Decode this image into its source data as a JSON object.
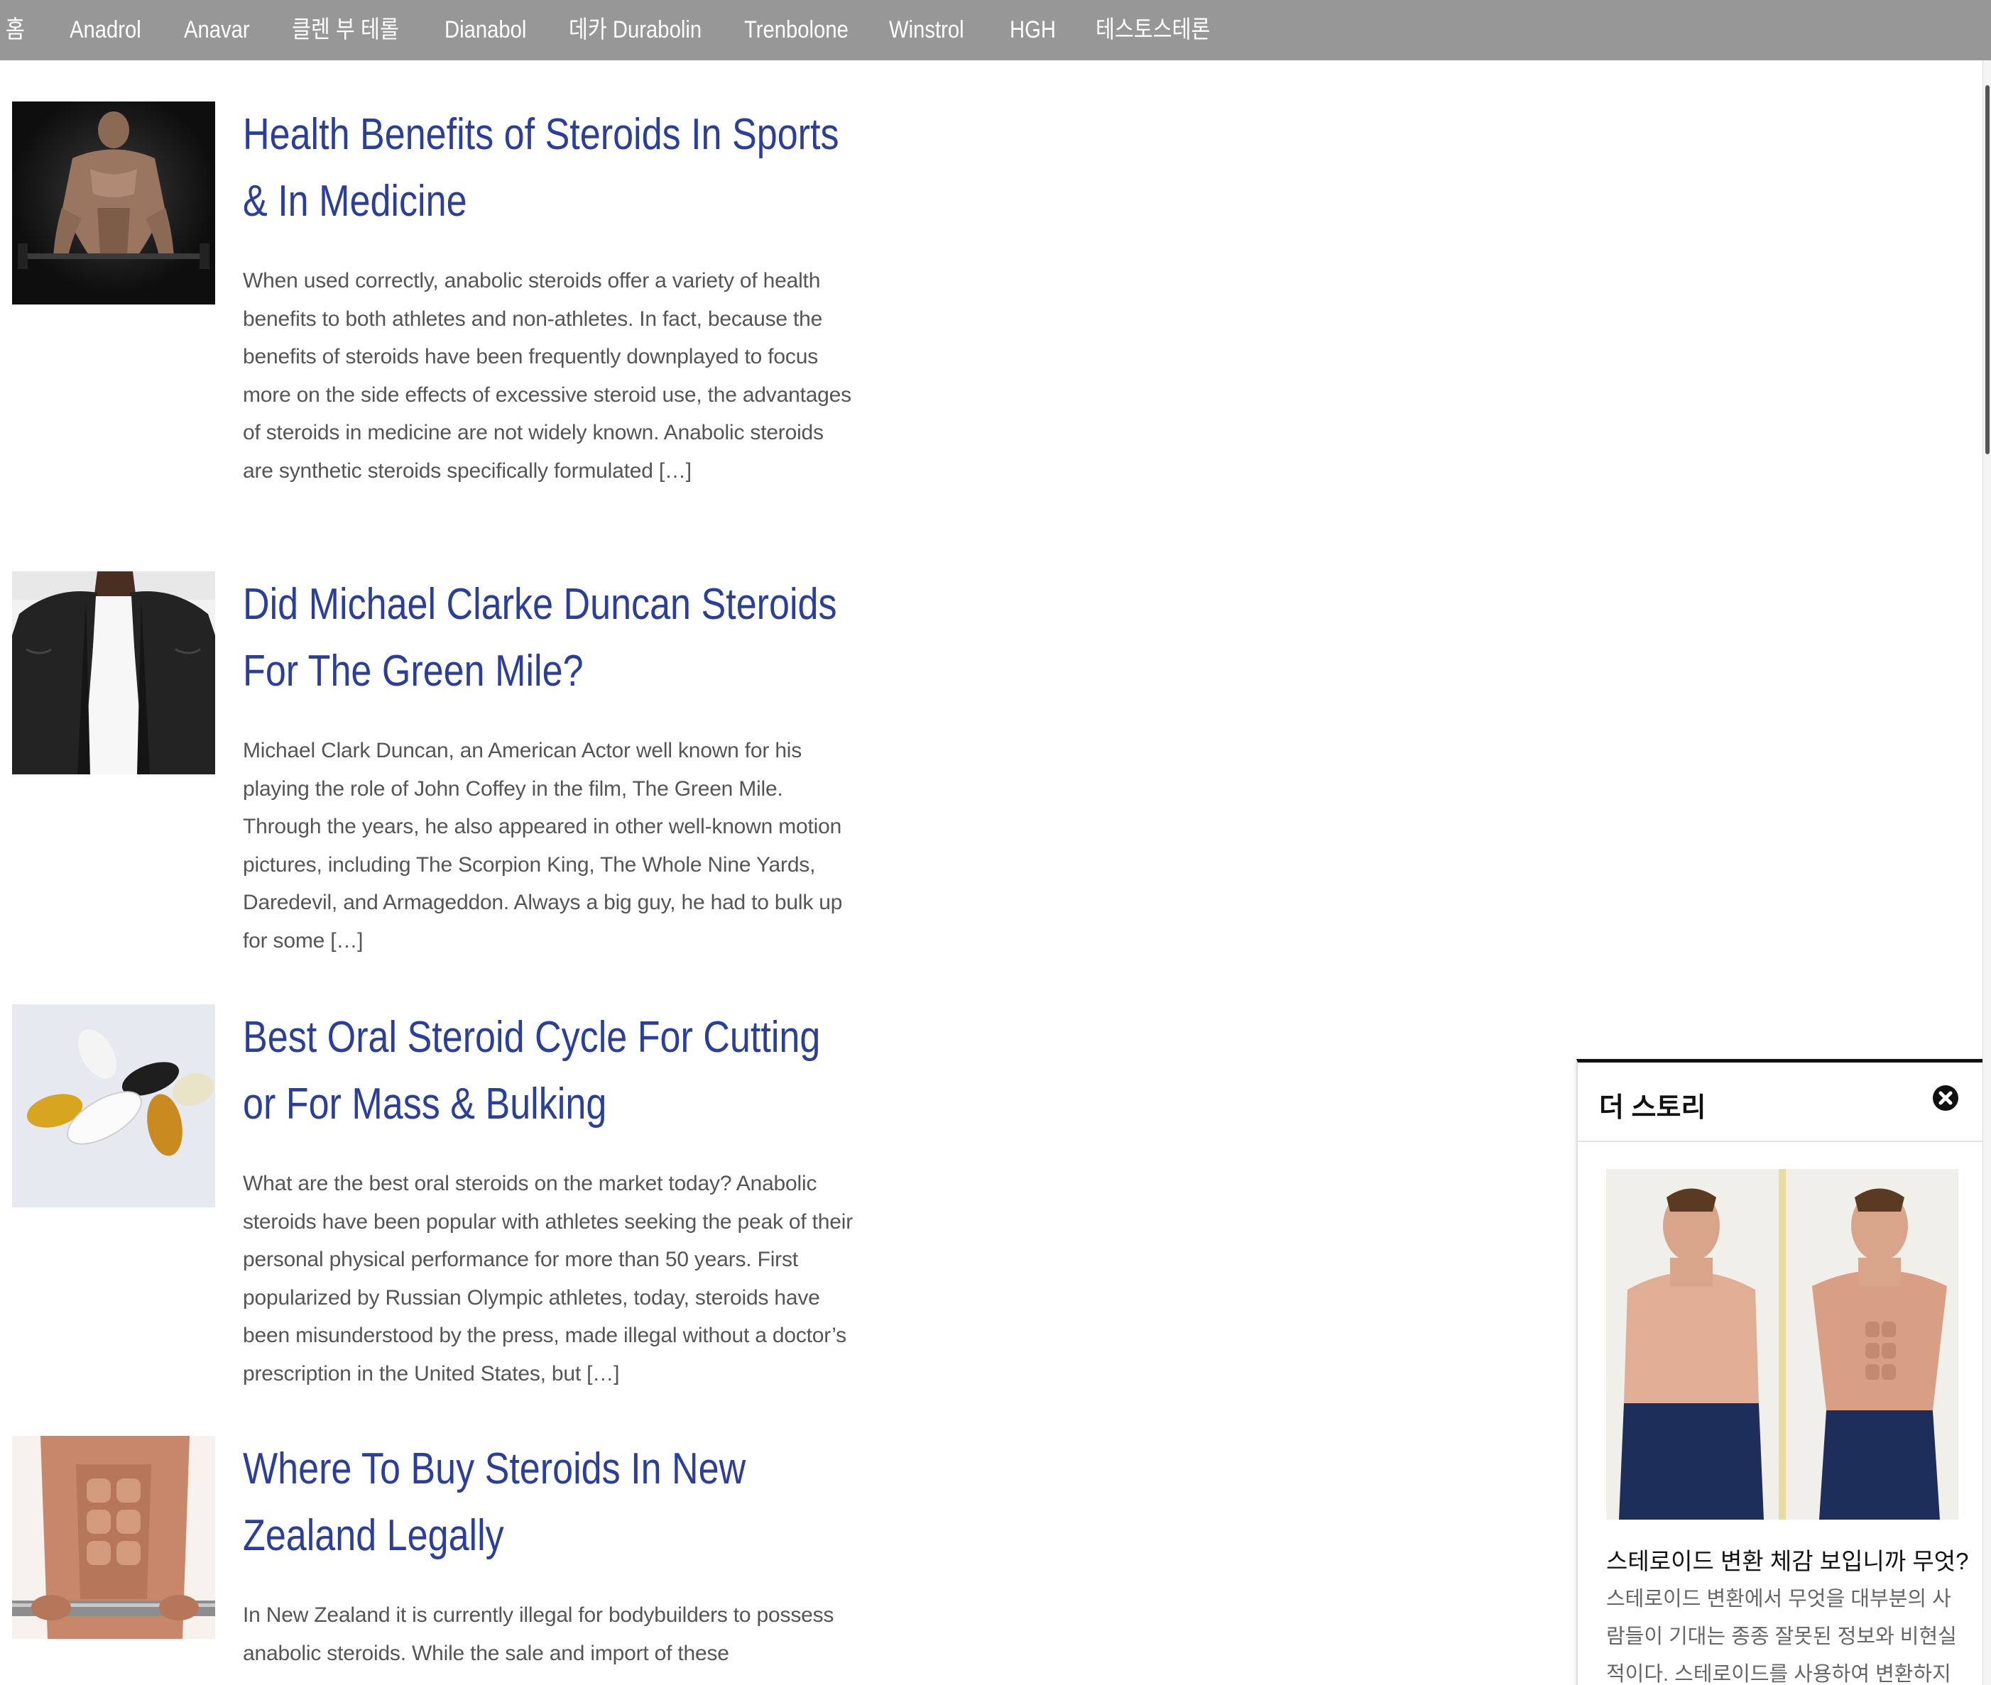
{
  "nav": {
    "items": [
      {
        "label": "홈"
      },
      {
        "label": "Anadrol"
      },
      {
        "label": "Anavar"
      },
      {
        "label": "클렌 부 테롤"
      },
      {
        "label": "Dianabol"
      },
      {
        "label": "데카 Durabolin"
      },
      {
        "label": "Trenbolone"
      },
      {
        "label": "Winstrol"
      },
      {
        "label": "HGH"
      },
      {
        "label": "테스토스테론"
      }
    ]
  },
  "articles": [
    {
      "title": "Health Benefits of Steroids In Sports & In Medicine",
      "excerpt": "When used correctly, anabolic steroids offer a variety of health benefits to both athletes and non-athletes. In fact, because the benefits of steroids have been frequently downplayed to focus more on the side effects of excessive steroid use, the advantages of steroids in medicine are not widely known. Anabolic steroids are synthetic steroids specifically formulated […]"
    },
    {
      "title": "Did Michael Clarke Duncan Steroids For The Green Mile?",
      "excerpt": "Michael Clark Duncan, an American Actor well known for his playing the role of John Coffey in the film, The Green Mile. Through the years, he also appeared in other well-known motion pictures, including The Scorpion King, The Whole Nine Yards, Daredevil, and Armageddon. Always a big guy, he had to bulk up for some […]"
    },
    {
      "title": "Best Oral Steroid Cycle For Cutting or For Mass & Bulking",
      "excerpt": "What are the best oral steroids on the market today? Anabolic steroids have been popular with athletes seeking the peak of their personal physical performance for more than 50 years. First popularized by Russian Olympic athletes, today, steroids have been misunderstood by the press, made illegal without a doctor’s prescription in the United States, but […]"
    },
    {
      "title": "Where To Buy Steroids In New Zealand Legally",
      "excerpt": "In New Zealand it is currently illegal for bodybuilders to possess anabolic steroids. While the sale and import of these"
    }
  ],
  "story": {
    "title": "더 스토리",
    "headline": "스테로이드 변환 체감 보입니까 무엇?",
    "body": "스테로이드 변환에서 무엇을 대부분의 사람들이 기대는 종종 잘못된 정보와 비현실적이다. 스테로이드를 사용하여 변환하지"
  },
  "icons": {
    "close": "close-circle-icon"
  },
  "colors": {
    "nav_bg": "#979797",
    "title": "#2a3f9d",
    "excerpt": "#555555"
  }
}
